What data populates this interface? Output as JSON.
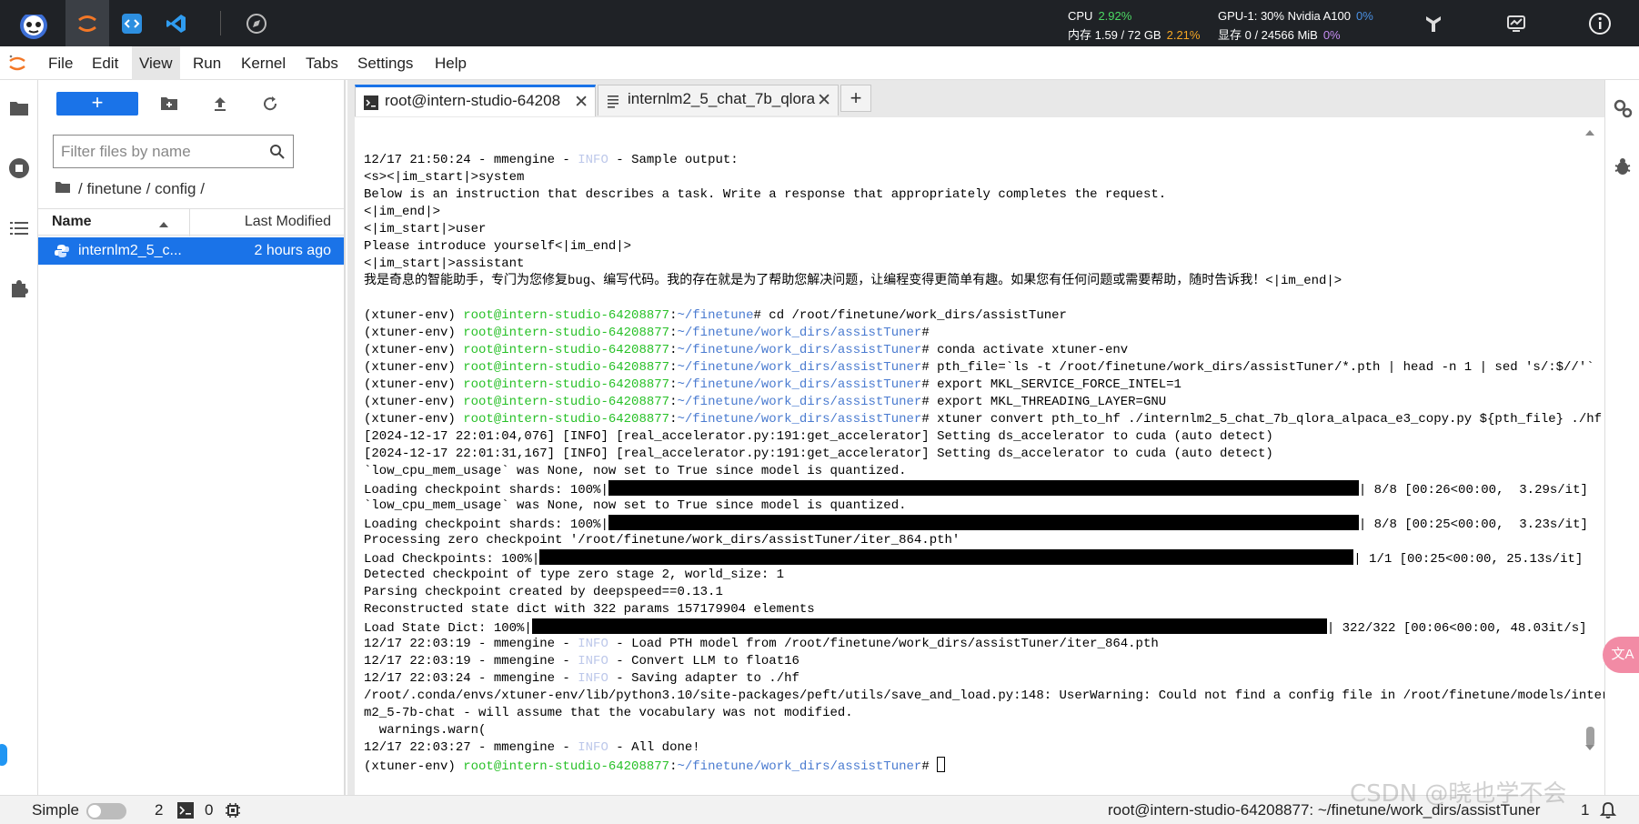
{
  "topbar": {
    "cpu_label": "CPU",
    "cpu_value": "2.92%",
    "mem_label": "内存 1.59 / 72 GB",
    "mem_value": "2.21%",
    "gpu_label": "GPU-1: 30% Nvidia A100",
    "gpu_value": "0%",
    "vram_label": "显存 0 / 24566 MiB",
    "vram_value": "0%",
    "colors": {
      "green": "#4cd964",
      "orange": "#f5a623",
      "blue": "#4a90e2",
      "purple": "#c48cf0"
    }
  },
  "menu": {
    "items": [
      "File",
      "Edit",
      "View",
      "Run",
      "Kernel",
      "Tabs",
      "Settings",
      "Help"
    ],
    "active": "View"
  },
  "filebrowser": {
    "new_label": "+",
    "filter_placeholder": "Filter files by name",
    "breadcrumb": "/ finetune / config /",
    "col_name": "Name",
    "col_modified": "Last Modified",
    "files": [
      {
        "name": "internlm2_5_c...",
        "modified": "2 hours ago",
        "icon": "python-icon"
      }
    ]
  },
  "tabs": [
    {
      "label": "root@intern-studio-64208",
      "icon": "terminal-icon",
      "active": true
    },
    {
      "label": "internlm2_5_chat_7b_qlora",
      "icon": "text-file-icon",
      "active": false
    }
  ],
  "terminal": {
    "prompt_env": "(xtuner-env)",
    "prompt_host": "root@intern-studio-64208877",
    "colors": {
      "host": "#28c128",
      "path": "#4a7bd0",
      "info": "#bdc8ea"
    },
    "lines": [
      {
        "segs": [
          {
            "t": "12/17 21:50:24 - mmengine - "
          },
          {
            "t": "INFO",
            "c": "dim"
          },
          {
            "t": " - Sample output:"
          }
        ]
      },
      {
        "segs": [
          {
            "t": "<s><|im_start|>system"
          }
        ]
      },
      {
        "segs": [
          {
            "t": "Below is an instruction that describes a task. Write a response that appropriately completes the request."
          }
        ]
      },
      {
        "segs": [
          {
            "t": "<|im_end|>"
          }
        ]
      },
      {
        "segs": [
          {
            "t": "<|im_start|>user"
          }
        ]
      },
      {
        "segs": [
          {
            "t": "Please introduce yourself<|im_end|>"
          }
        ]
      },
      {
        "segs": [
          {
            "t": "<|im_start|>assistant"
          }
        ]
      },
      {
        "segs": [
          {
            "t": "我是奇息的智能助手，专门为您修复bug、编写代码。我的存在就是为了帮助您解决问题，让编程变得更简单有趣。如果您有任何问题或需要帮助，随时告诉我！<|im_end|>"
          }
        ]
      },
      {
        "segs": [
          {
            "t": ""
          }
        ]
      },
      {
        "segs": [
          {
            "t": "(xtuner-env) "
          },
          {
            "t": "root@intern-studio-64208877",
            "c": "green"
          },
          {
            "t": ":"
          },
          {
            "t": "~/finetune",
            "c": "blue"
          },
          {
            "t": "# cd /root/finetune/work_dirs/assistTuner"
          }
        ]
      },
      {
        "segs": [
          {
            "t": "(xtuner-env) "
          },
          {
            "t": "root@intern-studio-64208877",
            "c": "green"
          },
          {
            "t": ":"
          },
          {
            "t": "~/finetune/work_dirs/assistTuner",
            "c": "blue"
          },
          {
            "t": "#"
          }
        ]
      },
      {
        "segs": [
          {
            "t": "(xtuner-env) "
          },
          {
            "t": "root@intern-studio-64208877",
            "c": "green"
          },
          {
            "t": ":"
          },
          {
            "t": "~/finetune/work_dirs/assistTuner",
            "c": "blue"
          },
          {
            "t": "# conda activate xtuner-env"
          }
        ]
      },
      {
        "segs": [
          {
            "t": "(xtuner-env) "
          },
          {
            "t": "root@intern-studio-64208877",
            "c": "green"
          },
          {
            "t": ":"
          },
          {
            "t": "~/finetune/work_dirs/assistTuner",
            "c": "blue"
          },
          {
            "t": "# pth_file=`ls -t /root/finetune/work_dirs/assistTuner/*.pth | head -n 1 | sed 's/:$//'`"
          }
        ]
      },
      {
        "segs": [
          {
            "t": "(xtuner-env) "
          },
          {
            "t": "root@intern-studio-64208877",
            "c": "green"
          },
          {
            "t": ":"
          },
          {
            "t": "~/finetune/work_dirs/assistTuner",
            "c": "blue"
          },
          {
            "t": "# export MKL_SERVICE_FORCE_INTEL=1"
          }
        ]
      },
      {
        "segs": [
          {
            "t": "(xtuner-env) "
          },
          {
            "t": "root@intern-studio-64208877",
            "c": "green"
          },
          {
            "t": ":"
          },
          {
            "t": "~/finetune/work_dirs/assistTuner",
            "c": "blue"
          },
          {
            "t": "# export MKL_THREADING_LAYER=GNU"
          }
        ]
      },
      {
        "segs": [
          {
            "t": "(xtuner-env) "
          },
          {
            "t": "root@intern-studio-64208877",
            "c": "green"
          },
          {
            "t": ":"
          },
          {
            "t": "~/finetune/work_dirs/assistTuner",
            "c": "blue"
          },
          {
            "t": "# xtuner convert pth_to_hf ./internlm2_5_chat_7b_qlora_alpaca_e3_copy.py ${pth_file} ./hf"
          }
        ]
      },
      {
        "segs": [
          {
            "t": "[2024-12-17 22:01:04,076] [INFO] [real_accelerator.py:191:get_accelerator] Setting ds_accelerator to cuda (auto detect)"
          }
        ]
      },
      {
        "segs": [
          {
            "t": "[2024-12-17 22:01:31,167] [INFO] [real_accelerator.py:191:get_accelerator] Setting ds_accelerator to cuda (auto detect)"
          }
        ]
      },
      {
        "segs": [
          {
            "t": "`low_cpu_mem_usage` was None, now set to True since model is quantized."
          }
        ]
      },
      {
        "segs": [
          {
            "t": "Loading checkpoint shards: 100%|"
          },
          {
            "bar": 825
          },
          {
            "t": "| 8/8 [00:26<00:00,  3.29s/it]"
          }
        ]
      },
      {
        "segs": [
          {
            "t": "`low_cpu_mem_usage` was None, now set to True since model is quantized."
          }
        ]
      },
      {
        "segs": [
          {
            "t": "Loading checkpoint shards: 100%|"
          },
          {
            "bar": 825
          },
          {
            "t": "| 8/8 [00:25<00:00,  3.23s/it]"
          }
        ]
      },
      {
        "segs": [
          {
            "t": "Processing zero checkpoint '/root/finetune/work_dirs/assistTuner/iter_864.pth'"
          }
        ]
      },
      {
        "segs": [
          {
            "t": "Load Checkpoints: 100%|"
          },
          {
            "bar": 895
          },
          {
            "t": "| 1/1 [00:25<00:00, 25.13s/it]"
          }
        ]
      },
      {
        "segs": [
          {
            "t": "Detected checkpoint of type zero stage 2, world_size: 1"
          }
        ]
      },
      {
        "segs": [
          {
            "t": "Parsing checkpoint created by deepspeed==0.13.1"
          }
        ]
      },
      {
        "segs": [
          {
            "t": "Reconstructed state dict with 322 params 157179904 elements"
          }
        ]
      },
      {
        "segs": [
          {
            "t": "Load State Dict: 100%|"
          },
          {
            "bar": 874
          },
          {
            "t": "| 322/322 [00:06<00:00, 48.03it/s]"
          }
        ]
      },
      {
        "segs": [
          {
            "t": "12/17 22:03:19 - mmengine - "
          },
          {
            "t": "INFO",
            "c": "dim"
          },
          {
            "t": " - Load PTH model from /root/finetune/work_dirs/assistTuner/iter_864.pth"
          }
        ]
      },
      {
        "segs": [
          {
            "t": "12/17 22:03:19 - mmengine - "
          },
          {
            "t": "INFO",
            "c": "dim"
          },
          {
            "t": " - Convert LLM to float16"
          }
        ]
      },
      {
        "segs": [
          {
            "t": "12/17 22:03:24 - mmengine - "
          },
          {
            "t": "INFO",
            "c": "dim"
          },
          {
            "t": " - Saving adapter to ./hf"
          }
        ]
      },
      {
        "segs": [
          {
            "t": "/root/.conda/envs/xtuner-env/lib/python3.10/site-packages/peft/utils/save_and_load.py:148: UserWarning: Could not find a config file in /root/finetune/models/internl"
          }
        ]
      },
      {
        "segs": [
          {
            "t": "m2_5-7b-chat - will assume that the vocabulary was not modified."
          }
        ]
      },
      {
        "segs": [
          {
            "t": "  warnings.warn("
          }
        ]
      },
      {
        "segs": [
          {
            "t": "12/17 22:03:27 - mmengine - "
          },
          {
            "t": "INFO",
            "c": "dim"
          },
          {
            "t": " - All done!"
          }
        ]
      },
      {
        "segs": [
          {
            "t": "(xtuner-env) "
          },
          {
            "t": "root@intern-studio-64208877",
            "c": "green"
          },
          {
            "t": ":"
          },
          {
            "t": "~/finetune/work_dirs/assistTuner",
            "c": "blue"
          },
          {
            "t": "# "
          },
          {
            "cursor": true
          }
        ]
      }
    ]
  },
  "statusbar": {
    "simple_label": "Simple",
    "terminals_count": "2",
    "kernels_count": "0",
    "path": "root@intern-studio-64208877: ~/finetune/work_dirs/assistTuner",
    "line_num": "1"
  },
  "watermark": "CSDN @晓也学不会"
}
